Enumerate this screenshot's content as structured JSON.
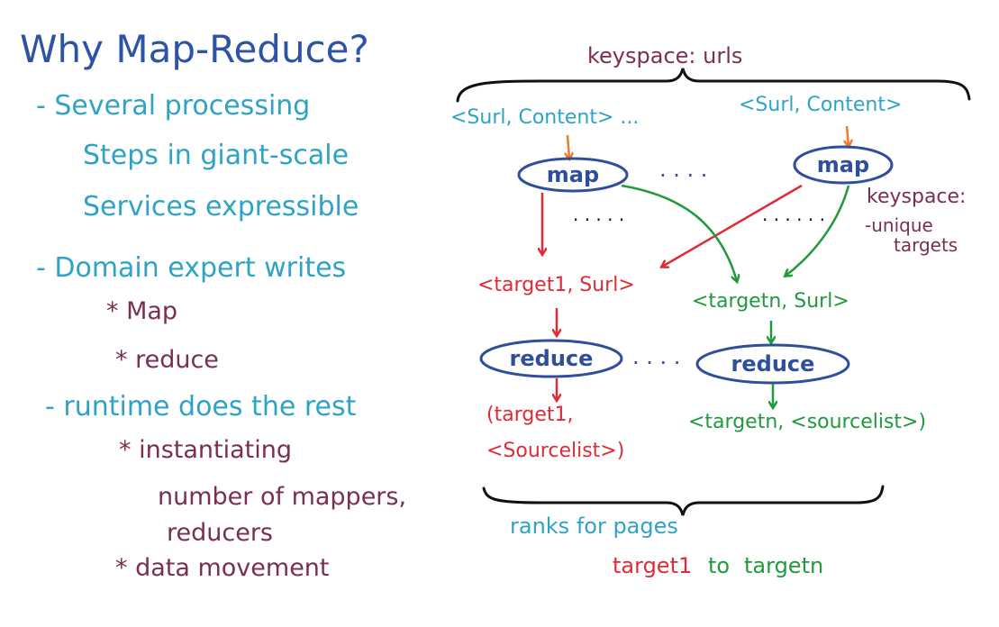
{
  "title": "Why Map-Reduce?",
  "left_notes": {
    "point1": [
      "- Several processing",
      "Steps in giant-scale",
      "Services expressible"
    ],
    "point2": "- Domain expert writes",
    "point2_items": [
      "* Map",
      "* reduce"
    ],
    "point3": "- runtime does the rest",
    "point3_item1": "* instantiating",
    "point3_item1_detail": [
      "number of mappers,",
      "reducers"
    ],
    "point3_item2": "* data movement"
  },
  "diagram": {
    "keyspace_top": "keyspace: urls",
    "input_left": "<Surl, Content> ...",
    "input_right": "<Surl, Content>",
    "map_left": "map",
    "map_right": "map",
    "map_ellipsis": ". . . .",
    "mid_dots_left": ". . . . .",
    "mid_dots_right": ". . . . . .",
    "keyspace_side": [
      "keyspace:",
      "-unique",
      "targets"
    ],
    "pair_left": "<target1, Surl>",
    "pair_right": "<targetn, Surl>",
    "reduce_left": "reduce",
    "reduce_right": "reduce",
    "reduce_ellipsis": ". . . .",
    "out_left": [
      "(target1,",
      "<Sourcelist>)"
    ],
    "out_right": "<targetn, <sourcelist>)",
    "bottom_caption": "ranks for pages",
    "bottom_target_start": "target1",
    "bottom_to": "to",
    "bottom_target_end": "targetn"
  },
  "colors": {
    "title": "#2e53a5",
    "teal": "#2fa3c6",
    "plum": "#7a2e54",
    "red": "#e02a35",
    "green": "#1f9a3c",
    "orange": "#ef7a2a",
    "node_border": "#2f4e9c",
    "brace": "#111111"
  }
}
